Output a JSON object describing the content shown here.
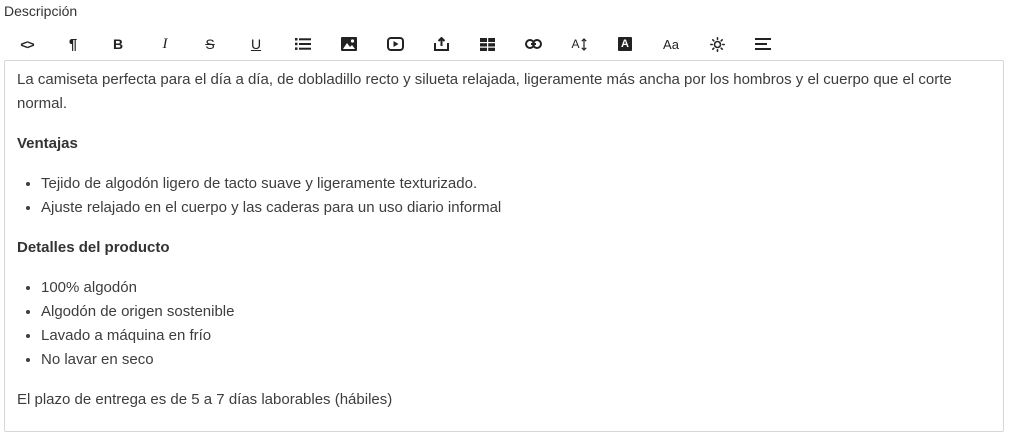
{
  "field": {
    "label": "Descripción"
  },
  "toolbar": {
    "bold_glyph": "B",
    "italic_glyph": "I",
    "strike_glyph": "S",
    "underline_glyph": "U",
    "font_size_glyph": "A",
    "text_color_glyph": "A",
    "font_family_glyph": "Aa",
    "paragraph_glyph": "¶",
    "code_glyph": "<>"
  },
  "editor": {
    "intro": "La camiseta perfecta para el día a día, de dobladillo recto y silueta relajada, ligeramente más ancha por los hombros y el cuerpo que el corte normal.",
    "section1": {
      "heading": "Ventajas",
      "items": [
        "Tejido de algodón ligero de tacto suave y ligeramente texturizado.",
        "Ajuste relajado en el cuerpo y las caderas para un uso diario informal"
      ]
    },
    "section2": {
      "heading": "Detalles del producto",
      "items": [
        "100% algodón",
        "Algodón de origen sostenible",
        "Lavado a máquina en frío",
        "No lavar en seco"
      ]
    },
    "footer": "El plazo de entrega es de 5 a 7 días laborables (hábiles)"
  }
}
